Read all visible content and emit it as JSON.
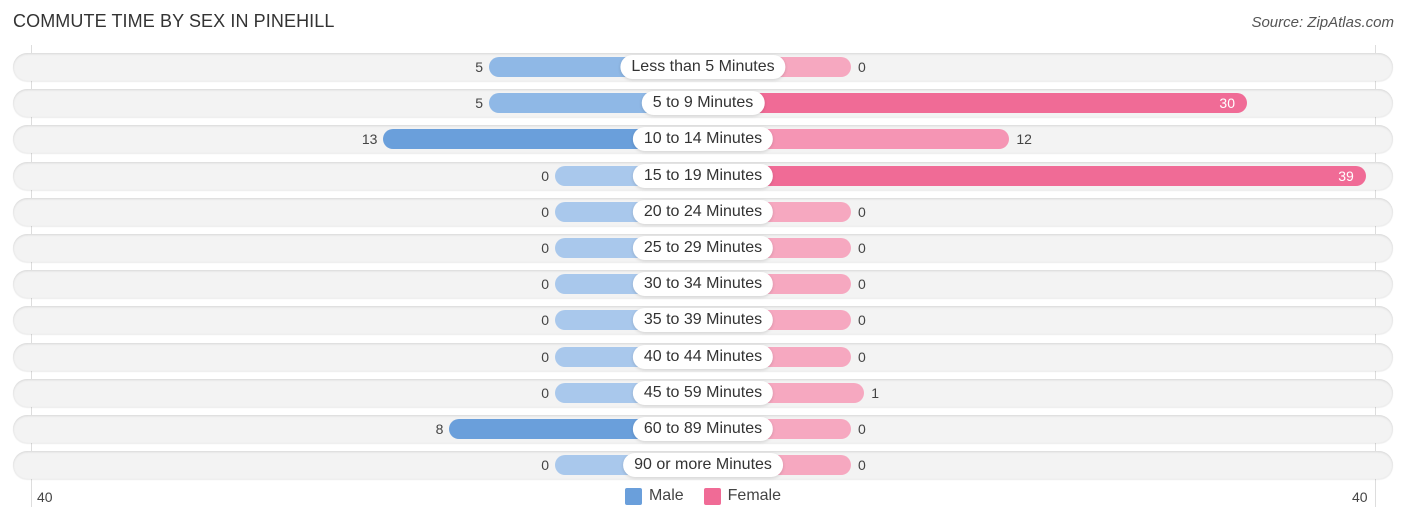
{
  "title": "COMMUTE TIME BY SEX IN PINEHILL",
  "source": "Source: ZipAtlas.com",
  "colors": {
    "male": "#6a9fdb",
    "male_light": "#a9c8ec",
    "female": "#f06b96",
    "female_light": "#f6a8c0"
  },
  "legend": {
    "male": "Male",
    "female": "Female"
  },
  "axis": {
    "left_label": "40",
    "right_label": "40"
  },
  "chart_data": {
    "type": "bar",
    "orientation": "horizontal-diverging",
    "title": "COMMUTE TIME BY SEX IN PINEHILL",
    "categories": [
      "Less than 5 Minutes",
      "5 to 9 Minutes",
      "10 to 14 Minutes",
      "15 to 19 Minutes",
      "20 to 24 Minutes",
      "25 to 29 Minutes",
      "30 to 34 Minutes",
      "35 to 39 Minutes",
      "40 to 44 Minutes",
      "45 to 59 Minutes",
      "60 to 89 Minutes",
      "90 or more Minutes"
    ],
    "series": [
      {
        "name": "Male",
        "side": "left",
        "values": [
          5,
          5,
          13,
          0,
          0,
          0,
          0,
          0,
          0,
          0,
          8,
          0
        ]
      },
      {
        "name": "Female",
        "side": "right",
        "values": [
          0,
          30,
          12,
          39,
          0,
          0,
          0,
          0,
          0,
          1,
          0,
          0
        ]
      }
    ],
    "xlim": [
      40,
      40
    ],
    "tick_labels": [
      "40",
      "40"
    ],
    "legend_position": "bottom-center",
    "grid": false
  }
}
